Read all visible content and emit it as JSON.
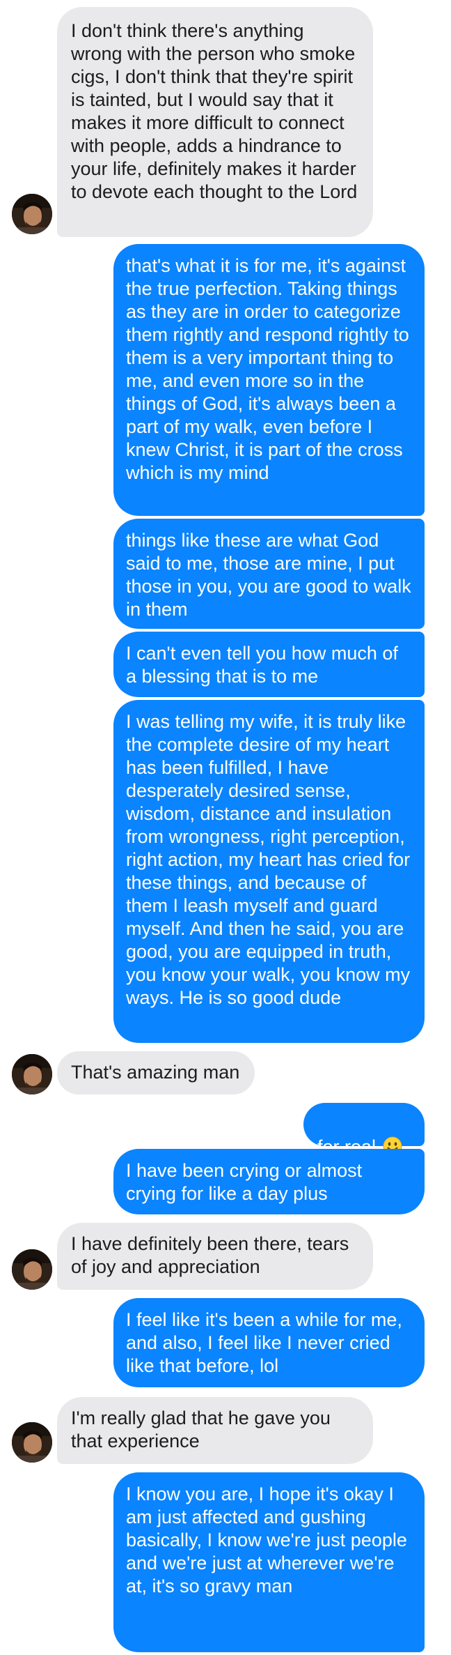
{
  "conversation": {
    "messages": [
      {
        "from": "contact",
        "text": "I don't think there's anything wrong with the person who smoke cigs, I don't think that they're spirit is tainted, but I would say that it makes it more difficult to connect with people, adds a hindrance to your life, definitely makes it harder to devote each thought to the Lord"
      },
      {
        "from": "me",
        "text": "that's what it is for me, it's against the true perfection. Taking things as they are in order to categorize them rightly and respond rightly to them is a very important thing to me, and even more so in the things of God, it's always been a part of my walk, even before I knew Christ, it is part of the cross which is my mind"
      },
      {
        "from": "me",
        "text": "things like these are what God said to me, those are mine, I put those in you, you are good to walk in them"
      },
      {
        "from": "me",
        "text": "I can't even tell you how much of a blessing that is to me"
      },
      {
        "from": "me",
        "text": "I was telling my wife, it is truly like the complete desire of my heart has been fulfilled, I have desperately desired sense, wisdom, distance and insulation from wrongness, right perception, right action, my heart has cried for these things, and because of them I leash myself and guard myself. And then he said, you are good, you are equipped in truth, you know your walk, you know my ways. He is so good dude"
      },
      {
        "from": "contact",
        "text": "That's amazing man"
      },
      {
        "from": "me",
        "text": "for real",
        "emoji": "smiling-face"
      },
      {
        "from": "me",
        "text": "I have been crying or almost crying for like a day plus"
      },
      {
        "from": "contact",
        "text": "I have definitely been there, tears of joy and appreciation"
      },
      {
        "from": "me",
        "text": "I feel like it's been a while for me, and also, I feel like I never cried like that before, lol"
      },
      {
        "from": "contact",
        "text": "I'm really glad that he gave you that experience"
      },
      {
        "from": "me",
        "text": "I know you are, I hope it's okay I am just affected and gushing basically, I know we're just people and we're just at wherever we're at, it's so gravy man"
      }
    ]
  },
  "colors": {
    "incoming_bubble": "#e9e9eb",
    "outgoing_bubble": "#0a84ff",
    "incoming_text": "#1c1c1e",
    "outgoing_text": "#ffffff"
  }
}
